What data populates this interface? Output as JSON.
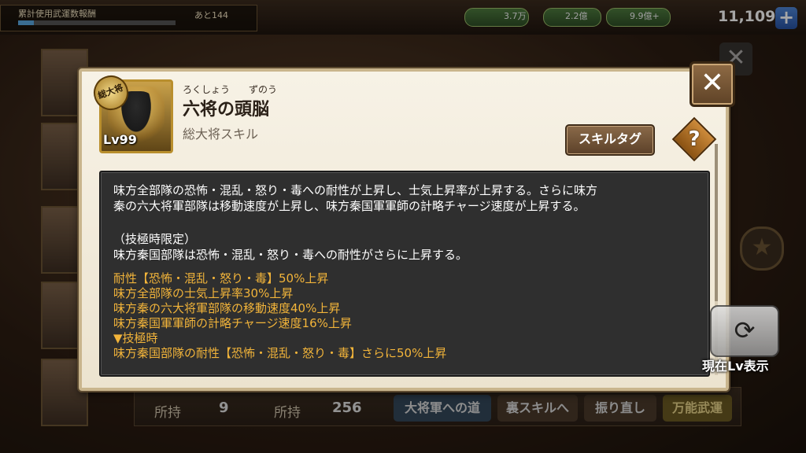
{
  "background": {
    "mission_title": "累計使用武運数報酬",
    "mission_remaining": "あと144",
    "mission_progress": 0.1,
    "resources": {
      "res1": "3.7万",
      "res2": "2.2億",
      "res3": "9.9億+",
      "gold": "11,109"
    },
    "plus_label": "+",
    "bottom": {
      "own_label_1": "所持",
      "own_value_1": "9",
      "own_label_2": "所持",
      "own_value_2": "256",
      "btn_path": "大将軍への道",
      "btn_ura": "裏スキルへ",
      "btn_reroll": "振り直し",
      "btn_banno": "万能武運"
    },
    "current_lv_label": "現在Lv表示"
  },
  "modal": {
    "skill": {
      "badge": "総大将",
      "level": "Lv99",
      "name": "六将の頭脳",
      "ruby_1": "ろくしょう",
      "ruby_2": "ずのう",
      "type": "総大将スキル"
    },
    "tag_button": "スキルタグ",
    "help_button": "?",
    "close_button": "✕",
    "description": {
      "line1": "味方全部隊の恐怖・混乱・怒り・毒への耐性が上昇し、士気上昇率が上昇する。さらに味方",
      "line2": "秦の六大将軍部隊は移動速度が上昇し、味方秦国軍軍師の計略チャージ速度が上昇する。",
      "line3": "（技極時限定）",
      "line4": "味方秦国部隊は恐怖・混乱・怒り・毒への耐性がさらに上昇する。",
      "gold1": "耐性【恐怖・混乱・怒り・毒】50%上昇",
      "gold2": "味方全部隊の士気上昇率30%上昇",
      "gold3": "味方秦の六大将軍部隊の移動速度40%上昇",
      "gold4": "味方秦国軍軍師の計略チャージ速度16%上昇",
      "gold5": "▼技極時",
      "gold6": "味方秦国部隊の耐性【恐怖・混乱・怒り・毒】さらに50%上昇"
    }
  },
  "colors": {
    "gold_text": "#f2b43a",
    "panel_bg": "#2f2f2f",
    "modal_bg": "#f7f2e6"
  }
}
